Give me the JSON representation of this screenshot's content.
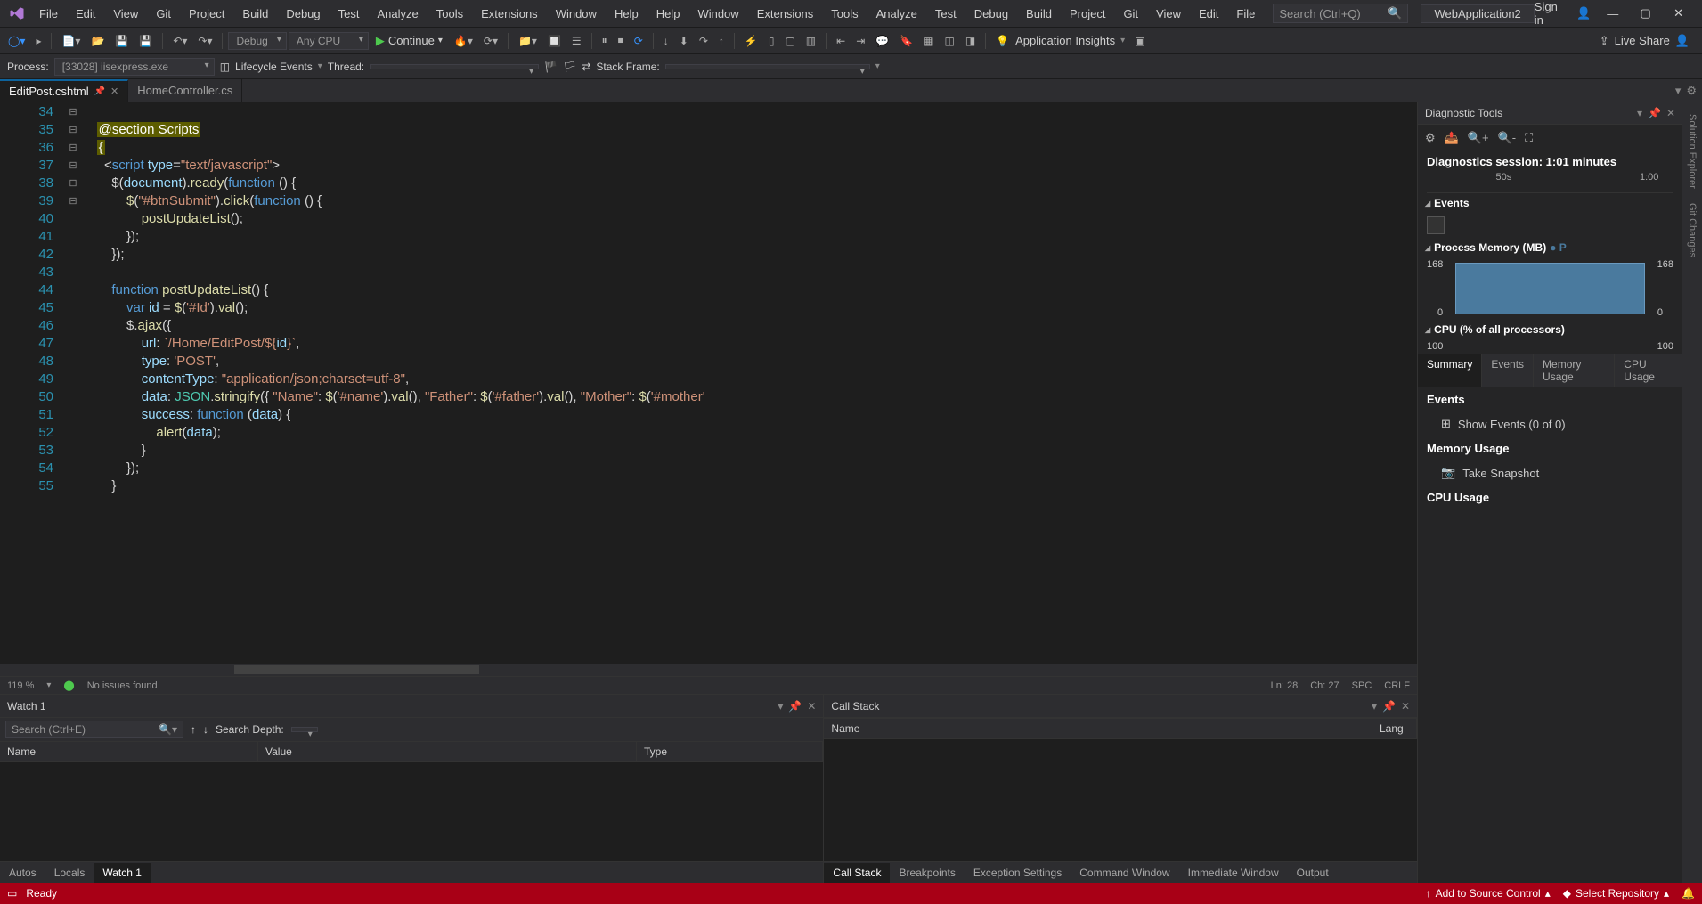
{
  "menubar": {
    "items": [
      "File",
      "Edit",
      "View",
      "Git",
      "Project",
      "Build",
      "Debug",
      "Test",
      "Analyze",
      "Tools",
      "Extensions",
      "Window",
      "Help"
    ],
    "search_placeholder": "Search (Ctrl+Q)",
    "app_name": "WebApplication2",
    "sign_in": "Sign in"
  },
  "toolbar": {
    "config": "Debug",
    "platform": "Any CPU",
    "continue": "Continue",
    "insights": "Application Insights",
    "live_share": "Live Share"
  },
  "debugbar": {
    "process_label": "Process:",
    "process_value": "[33028] iisexpress.exe",
    "lifecycle": "Lifecycle Events",
    "thread_label": "Thread:",
    "stack_label": "Stack Frame:"
  },
  "tabs": {
    "active": "EditPost.cshtml",
    "other": "HomeController.cs"
  },
  "editor": {
    "line_start": 34,
    "lines": [
      {
        "n": 34,
        "fold": "",
        "html": ""
      },
      {
        "n": 35,
        "fold": "",
        "html": "    <span class='hl-bg'>@section Scripts</span>"
      },
      {
        "n": 36,
        "fold": "",
        "html": "    <span class='hl-bg'>{</span>"
      },
      {
        "n": 37,
        "fold": "⊟",
        "html": "      <span class='op'>&lt;</span><span class='kw'>script</span> <span class='var'>type</span>=<span class='str'>\"text/javascript\"</span><span class='op'>&gt;</span>"
      },
      {
        "n": 38,
        "fold": "⊟",
        "html": "        $(<span class='var'>document</span>).<span class='fn'>ready</span>(<span class='kw'>function</span> () {"
      },
      {
        "n": 39,
        "fold": "⊟",
        "html": "            <span class='fn'>$</span>(<span class='str'>\"#btnSubmit\"</span>).<span class='fn'>click</span>(<span class='kw'>function</span> () {"
      },
      {
        "n": 40,
        "fold": "",
        "html": "                <span class='fn'>postUpdateList</span>();"
      },
      {
        "n": 41,
        "fold": "",
        "html": "            });"
      },
      {
        "n": 42,
        "fold": "",
        "html": "        });"
      },
      {
        "n": 43,
        "fold": "",
        "html": ""
      },
      {
        "n": 44,
        "fold": "⊟",
        "html": "        <span class='kw'>function</span> <span class='fn'>postUpdateList</span>() {"
      },
      {
        "n": 45,
        "fold": "",
        "html": "            <span class='kw'>var</span> <span class='var'>id</span> = <span class='fn'>$</span>(<span class='str'>'#Id'</span>).<span class='fn'>val</span>();"
      },
      {
        "n": 46,
        "fold": "⊟",
        "html": "            $.<span class='fn'>ajax</span>({"
      },
      {
        "n": 47,
        "fold": "",
        "html": "                <span class='var'>url</span>: <span class='str'>`/Home/EditPost/${</span><span class='var'>id</span><span class='str'>}`</span>,"
      },
      {
        "n": 48,
        "fold": "",
        "html": "                <span class='var'>type</span>: <span class='str'>'POST'</span>,"
      },
      {
        "n": 49,
        "fold": "",
        "html": "                <span class='var'>contentType</span>: <span class='str'>\"application/json;charset=utf-8\"</span>,"
      },
      {
        "n": 50,
        "fold": "",
        "html": "                <span class='var'>data</span>: <span class='type'>JSON</span>.<span class='fn'>stringify</span>({ <span class='str'>\"Name\"</span>: <span class='fn'>$</span>(<span class='str'>'#name'</span>).<span class='fn'>val</span>(), <span class='str'>\"Father\"</span>: <span class='fn'>$</span>(<span class='str'>'#father'</span>).<span class='fn'>val</span>(), <span class='str'>\"Mother\"</span>: <span class='fn'>$</span>(<span class='str'>'#mother'</span>"
      },
      {
        "n": 51,
        "fold": "⊟",
        "html": "                <span class='var'>success</span>: <span class='kw'>function</span> (<span class='var'>data</span>) {"
      },
      {
        "n": 52,
        "fold": "",
        "html": "                    <span class='fn'>alert</span>(<span class='var'>data</span>);"
      },
      {
        "n": 53,
        "fold": "",
        "html": "                }"
      },
      {
        "n": 54,
        "fold": "",
        "html": "            });"
      },
      {
        "n": 55,
        "fold": "",
        "html": "        }"
      }
    ],
    "status": {
      "zoom": "119 %",
      "issues": "No issues found",
      "ln": "Ln: 28",
      "ch": "Ch: 27",
      "spc": "SPC",
      "crlf": "CRLF"
    }
  },
  "diag": {
    "title": "Diagnostic Tools",
    "session": "Diagnostics session: 1:01 minutes",
    "ticks": [
      "50s",
      "1:00"
    ],
    "events_hdr": "Events",
    "mem_hdr": "Process Memory (MB)",
    "mem_max": "168",
    "mem_min": "0",
    "cpu_hdr": "CPU (% of all processors)",
    "cpu_max": "100",
    "cpu_min": "100",
    "tabs": [
      "Summary",
      "Events",
      "Memory Usage",
      "CPU Usage"
    ],
    "body": {
      "events": "Events",
      "show_events": "Show Events (0 of 0)",
      "mem": "Memory Usage",
      "snapshot": "Take Snapshot",
      "cpu": "CPU Usage"
    }
  },
  "right_tabs": [
    "Solution Explorer",
    "Git Changes"
  ],
  "watch": {
    "title": "Watch 1",
    "search_placeholder": "Search (Ctrl+E)",
    "depth_label": "Search Depth:",
    "cols": [
      "Name",
      "Value",
      "Type"
    ],
    "tabs": [
      "Autos",
      "Locals",
      "Watch 1"
    ]
  },
  "callstack": {
    "title": "Call Stack",
    "cols": [
      "Name",
      "Lang"
    ],
    "tabs": [
      "Call Stack",
      "Breakpoints",
      "Exception Settings",
      "Command Window",
      "Immediate Window",
      "Output"
    ]
  },
  "statusbar": {
    "ready": "Ready",
    "source_control": "Add to Source Control",
    "repo": "Select Repository"
  }
}
